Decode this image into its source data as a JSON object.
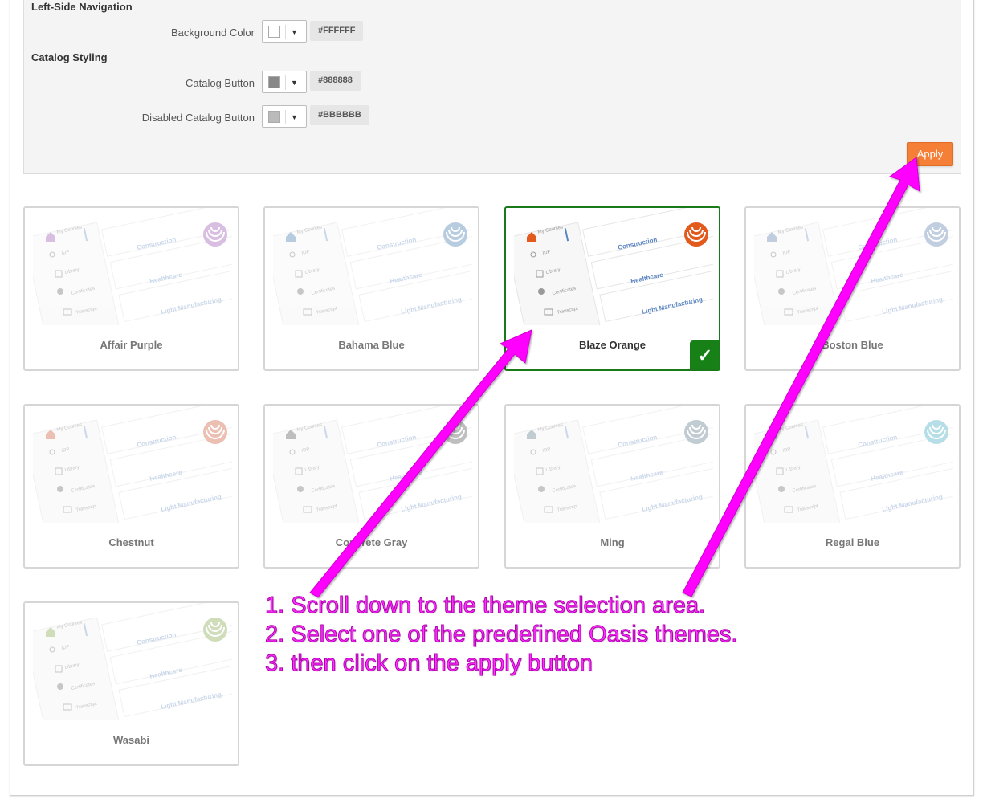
{
  "sections": {
    "left_nav_title": "Left-Side Navigation",
    "catalog_title": "Catalog Styling"
  },
  "rows": [
    {
      "label": "Background Color",
      "hex": "#FFFFFF",
      "color": "#ffffff"
    },
    {
      "label": "Catalog Button",
      "hex": "#888888",
      "color": "#888888"
    },
    {
      "label": "Disabled Catalog Button",
      "hex": "#BBBBBB",
      "color": "#bbbbbb"
    }
  ],
  "caret": "▼",
  "apply_label": "Apply",
  "preview_labels": {
    "my_courses": "My Courses",
    "idp": "IDP",
    "library": "Library",
    "certificates": "Certificates",
    "transcript": "Transcript",
    "construction": "Construction",
    "healthcare": "Healthcare",
    "light_manufacturing": "Light Manufacturing"
  },
  "themes": [
    {
      "name": "Affair Purple",
      "accent": "#b98ac9",
      "selected": false
    },
    {
      "name": "Bahama Blue",
      "accent": "#7fa3c6",
      "selected": false
    },
    {
      "name": "Blaze Orange",
      "accent": "#e25a1c",
      "selected": true
    },
    {
      "name": "Boston Blue",
      "accent": "#8fa6c5",
      "selected": false
    },
    {
      "name": "Chestnut",
      "accent": "#dc8c72",
      "selected": false
    },
    {
      "name": "Concrete Gray",
      "accent": "#8a8a8a",
      "selected": false
    },
    {
      "name": "Ming",
      "accent": "#8fa2ae",
      "selected": false
    },
    {
      "name": "Regal Blue",
      "accent": "#7cc4d4",
      "selected": false
    },
    {
      "name": "Wasabi",
      "accent": "#a8c284",
      "selected": false
    }
  ],
  "check_mark": "✓",
  "annotation": {
    "line1": "1. Scroll down to the theme selection area.",
    "line2": "2. Select one of the predefined Oasis themes.",
    "line3": "3. then click on the apply button"
  },
  "colors": {
    "arrow": "#ff00ff",
    "apply": "#f57f37",
    "selected_border": "#1a7a1a"
  }
}
